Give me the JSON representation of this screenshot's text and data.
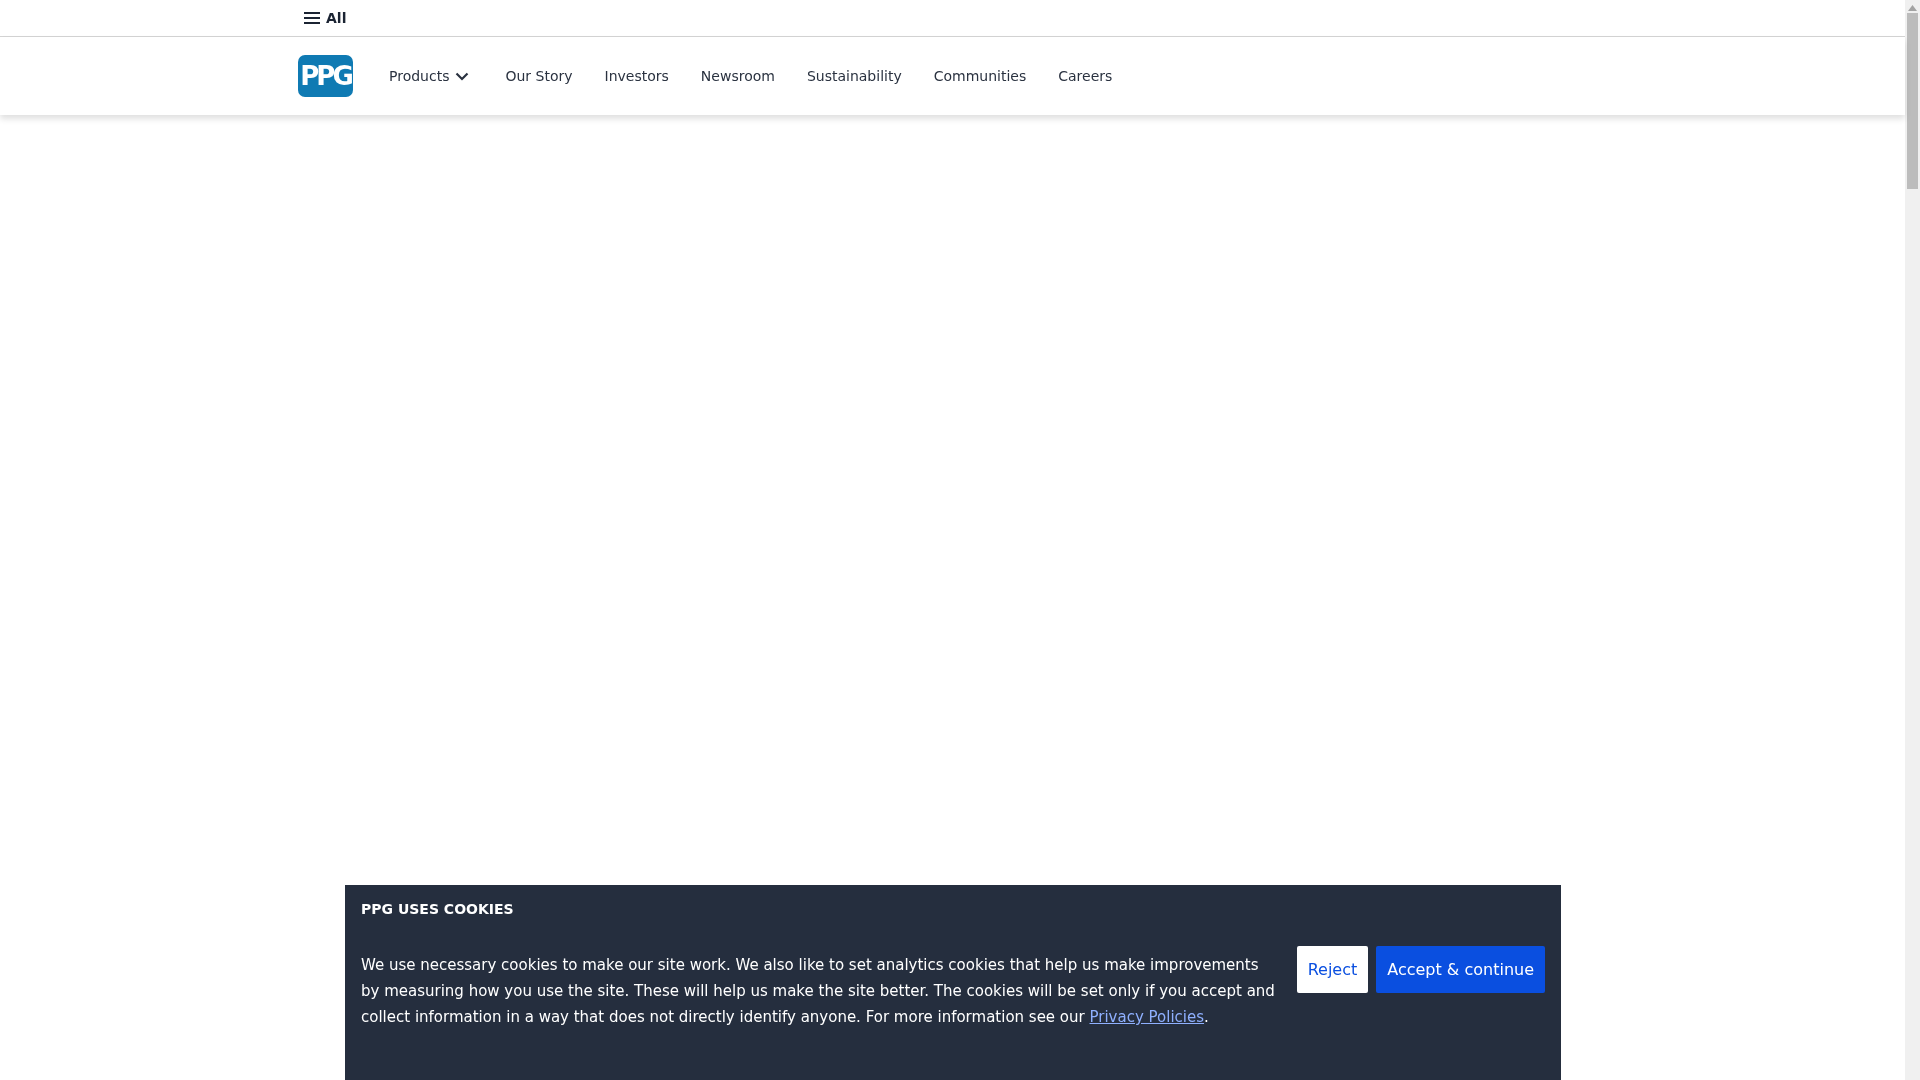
{
  "top_bar": {
    "menu_label": "All"
  },
  "nav": {
    "logo": "PPG",
    "items": [
      {
        "label": "Products",
        "has_dropdown": true
      },
      {
        "label": "Our Story",
        "has_dropdown": false
      },
      {
        "label": "Investors",
        "has_dropdown": false
      },
      {
        "label": "Newsroom",
        "has_dropdown": false
      },
      {
        "label": "Sustainability",
        "has_dropdown": false
      },
      {
        "label": "Communities",
        "has_dropdown": false
      },
      {
        "label": "Careers",
        "has_dropdown": false
      }
    ]
  },
  "cookie_banner": {
    "title": "PPG USES COOKIES",
    "text": "We use necessary cookies to make our site work. We also like to set analytics cookies that help us make improvements by measuring how you use the site. These will help us make the site better. The cookies will be set only if you accept and collect information in a way that does not directly identify anyone. For more information see our ",
    "link": "Privacy Policies",
    "text_end": ".",
    "buttons": [
      {
        "label": "Reject",
        "kind": "secondary"
      },
      {
        "label": "Accept & continue",
        "kind": "primary"
      }
    ]
  }
}
